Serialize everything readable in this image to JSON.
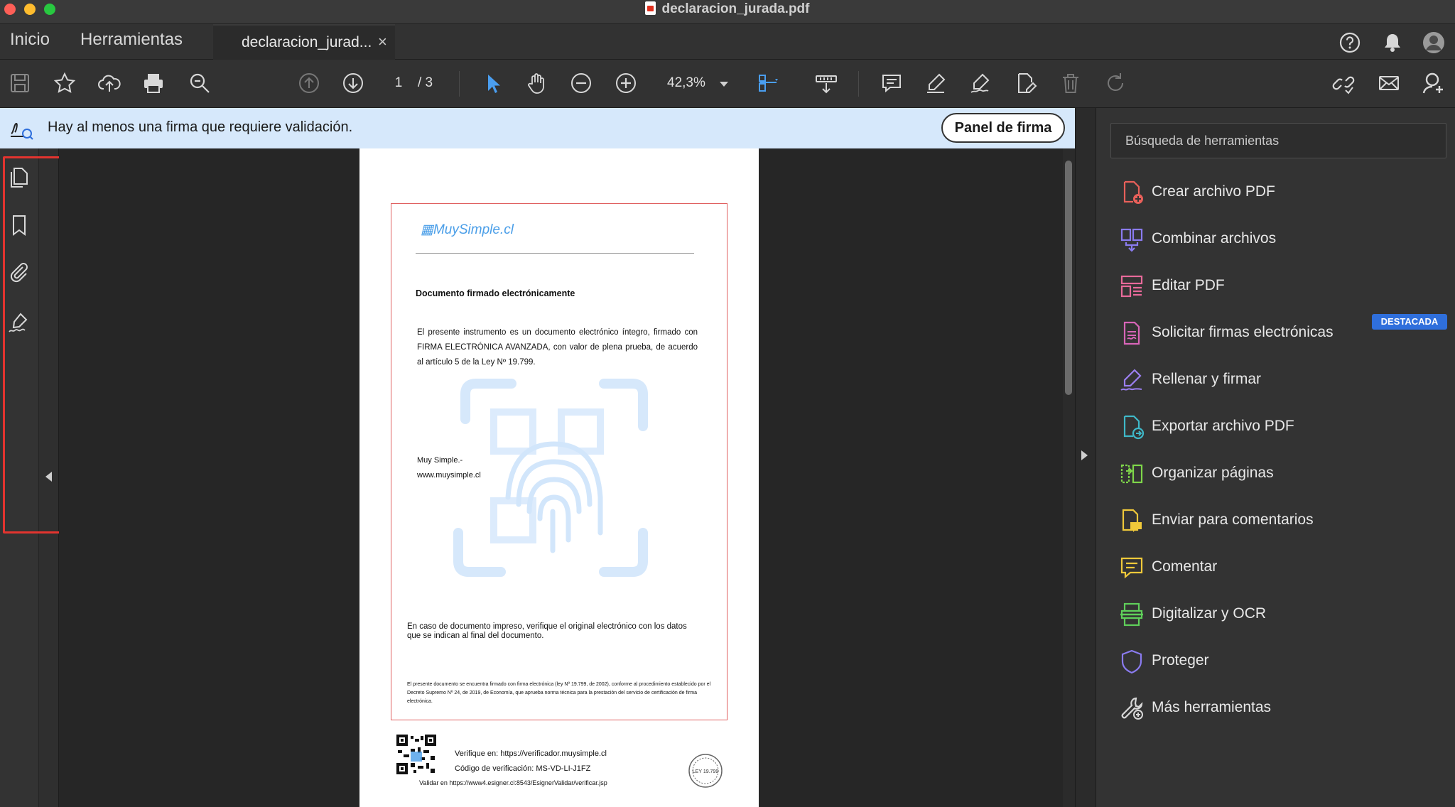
{
  "window": {
    "title": "declaracion_jurada.pdf"
  },
  "tabs": {
    "home": "Inicio",
    "tools": "Herramientas",
    "document": "declaracion_jurad...",
    "close": "×"
  },
  "toolbar": {
    "page_current": "1",
    "page_total": "/ 3",
    "zoom": "42,3%"
  },
  "notification": {
    "message": "Hay al menos una firma que requiere validación.",
    "button": "Panel de firma"
  },
  "document": {
    "logo": "MuySimple.cl",
    "heading": "Documento firmado electrónicamente",
    "paragraph": "El presente instrumento es un documento electrónico íntegro, firmado con FIRMA ELECTRÓNICA AVANZADA, con valor de plena prueba, de acuerdo al artículo 5 de la Ley Nº 19.799.",
    "sign_name": "Muy Simple.-",
    "sign_url": "www.muysimple.cl",
    "printed_note": "En caso de documento impreso, verifique el original electrónico con los datos que se indican al final del documento.",
    "legal": "El presente documento se encuentra firmado con firma electrónica (ley Nº 19.799, de 2002), conforme al procedimiento establecido por el Decreto Supremo Nº 24, de 2019, de Economía, que aprueba norma técnica para la prestación del servicio de certificación de firma electrónica.",
    "verify_url": "Verifique en: https://verificador.muysimple.cl",
    "verify_code": "Código de verificación: MS-VD-LI-J1FZ",
    "validate_url": "Validar en  https://www4.esigner.cl:8543/EsignerValidar/verificar.jsp",
    "seal_text": "LEY 19.799"
  },
  "right_panel": {
    "search_placeholder": "Búsqueda de herramientas",
    "badge": "DESTACADA",
    "tools": [
      {
        "label": "Crear archivo PDF",
        "icon": "create-pdf-icon",
        "color": "#e8605a"
      },
      {
        "label": "Combinar archivos",
        "icon": "combine-files-icon",
        "color": "#8a7bf0"
      },
      {
        "label": "Editar PDF",
        "icon": "edit-pdf-icon",
        "color": "#e86a9a"
      },
      {
        "label": "Solicitar firmas electrónicas",
        "icon": "request-signatures-icon",
        "color": "#d865b8"
      },
      {
        "label": "Rellenar y firmar",
        "icon": "fill-sign-icon",
        "color": "#9b7ff0"
      },
      {
        "label": "Exportar archivo PDF",
        "icon": "export-pdf-icon",
        "color": "#3fb8c8"
      },
      {
        "label": "Organizar páginas",
        "icon": "organize-pages-icon",
        "color": "#7fd64a"
      },
      {
        "label": "Enviar para comentarios",
        "icon": "send-comments-icon",
        "color": "#f0c93a"
      },
      {
        "label": "Comentar",
        "icon": "comment-icon",
        "color": "#f0c93a"
      },
      {
        "label": "Digitalizar y OCR",
        "icon": "scan-ocr-icon",
        "color": "#5fcf5a"
      },
      {
        "label": "Proteger",
        "icon": "protect-icon",
        "color": "#8a7bf0"
      },
      {
        "label": "Más herramientas",
        "icon": "more-tools-icon",
        "color": "#d8d8d8"
      }
    ]
  }
}
